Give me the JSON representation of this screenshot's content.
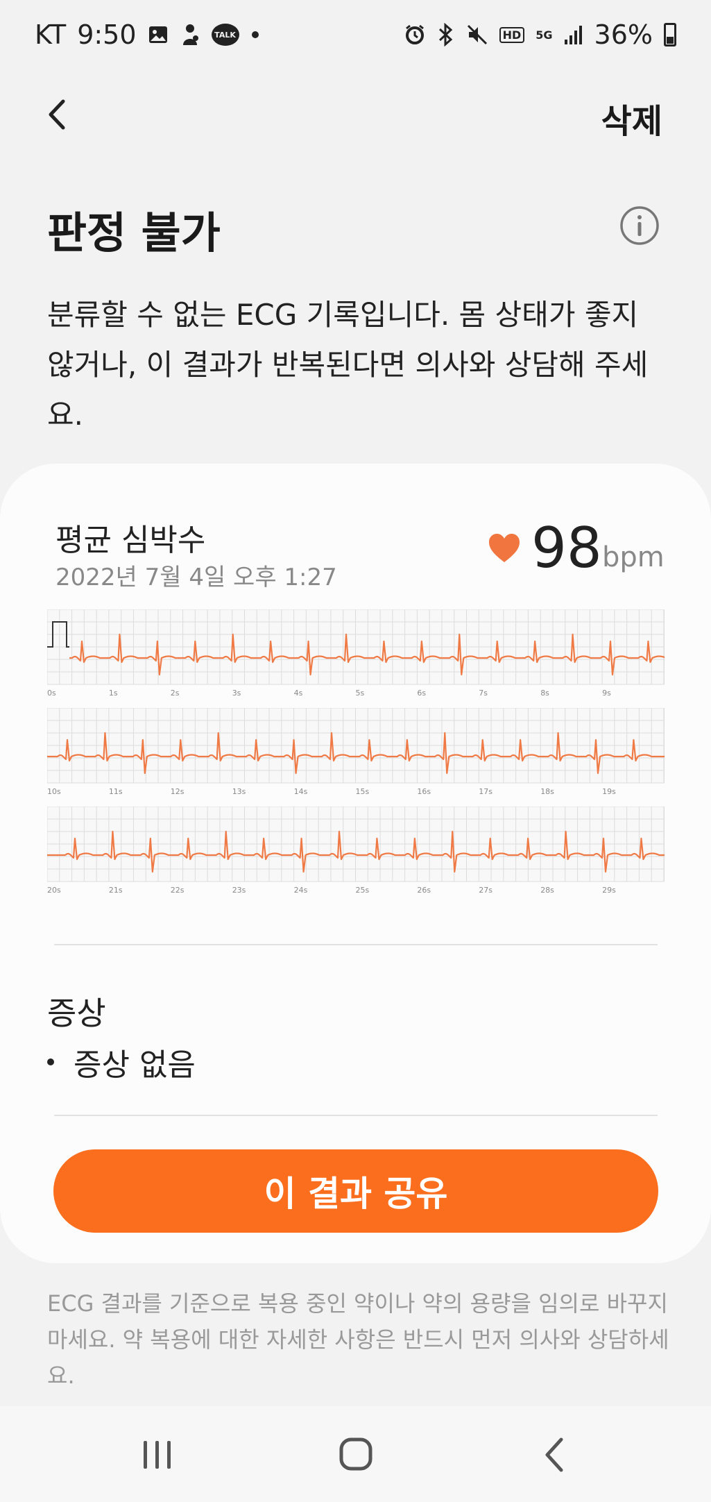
{
  "status_bar": {
    "carrier": "KT",
    "time": "9:50",
    "kakao_badge": "TALK",
    "hd_badge": "HD",
    "network": "5G",
    "battery": "36%"
  },
  "header": {
    "delete_label": "삭제"
  },
  "result": {
    "title": "판정 불가",
    "description": "분류할 수 없는 ECG 기록입니다. 몸 상태가 좋지 않거나, 이 결과가 반복된다면 의사와 상담해 주세요."
  },
  "card": {
    "avg_label": "평균 심박수",
    "datetime": "2022년 7월 4일 오후 1:27",
    "bpm_value": "98",
    "bpm_unit": "bpm",
    "ecg_strips": [
      {
        "ticks": [
          "0s",
          "1s",
          "2s",
          "3s",
          "4s",
          "5s",
          "6s",
          "7s",
          "8s",
          "9s"
        ]
      },
      {
        "ticks": [
          "10s",
          "11s",
          "12s",
          "13s",
          "14s",
          "15s",
          "16s",
          "17s",
          "18s",
          "19s"
        ]
      },
      {
        "ticks": [
          "20s",
          "21s",
          "22s",
          "23s",
          "24s",
          "25s",
          "26s",
          "27s",
          "28s",
          "29s"
        ]
      }
    ],
    "symptom_title": "증상",
    "symptom_item": "증상 없음",
    "share_label": "이 결과 공유"
  },
  "disclaimer": "ECG 결과를 기준으로 복용 중인 약이나 약의 용량을 임의로 바꾸지 마세요. 약 복용에 대한 자세한 사항은 반드시 먼저 의사와 상담하세요.",
  "colors": {
    "accent": "#fa6e1e",
    "ecg_line": "#f07a45",
    "grid": "#dcdcdc"
  }
}
